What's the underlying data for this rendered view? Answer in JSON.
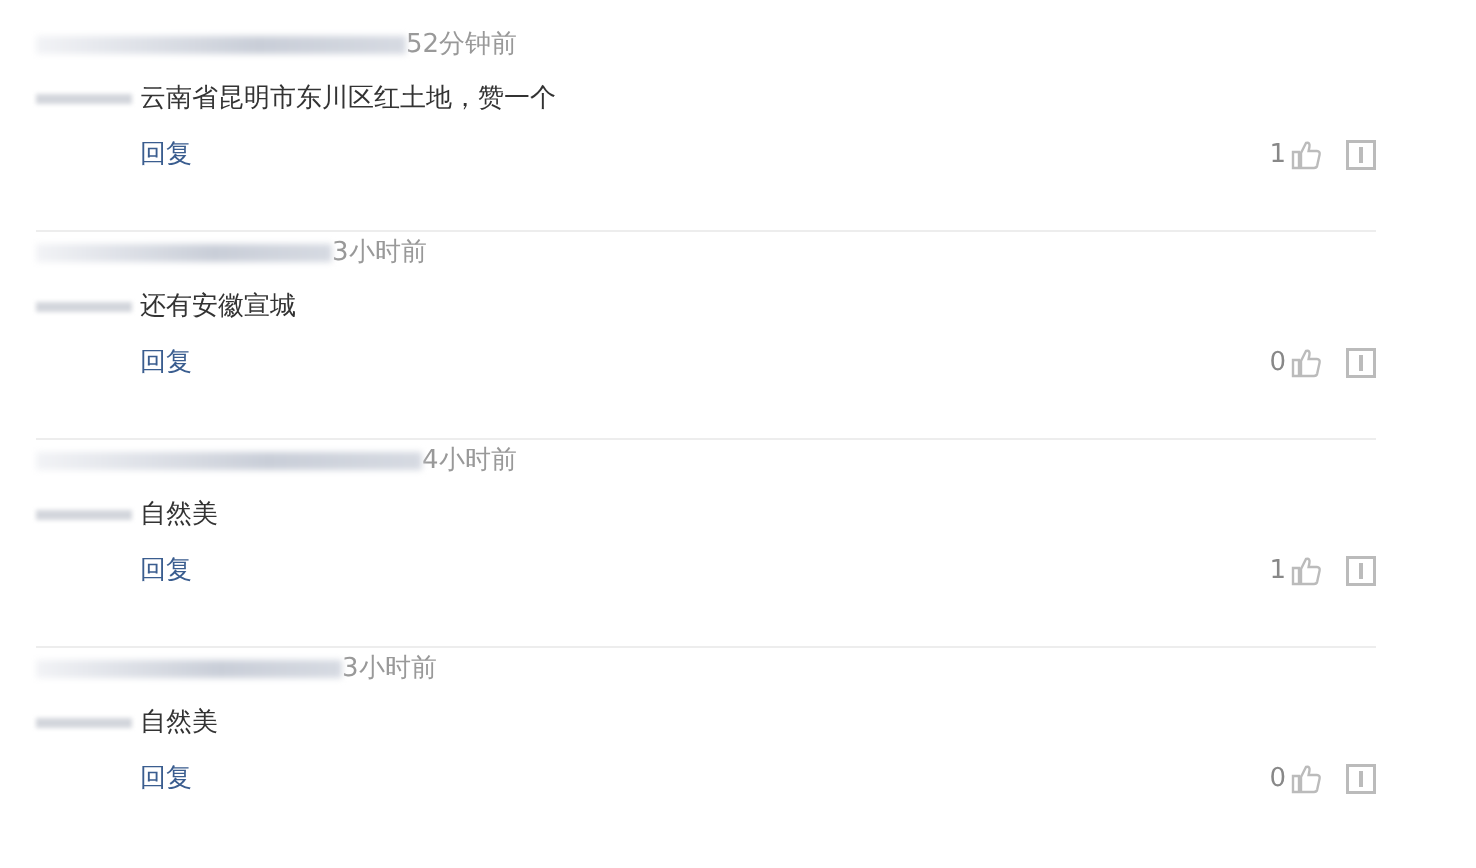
{
  "comments": [
    {
      "time": "52分钟前",
      "text": "云南省昆明市东川区红土地，赞一个",
      "reply": "回复",
      "likes": "1"
    },
    {
      "time": "3小时前",
      "text": "还有安徽宣城",
      "reply": "回复",
      "likes": "0"
    },
    {
      "time": "4小时前",
      "text": "自然美",
      "reply": "回复",
      "likes": "1"
    },
    {
      "time": "3小时前",
      "text": "自然美",
      "reply": "回复",
      "likes": "0"
    }
  ]
}
